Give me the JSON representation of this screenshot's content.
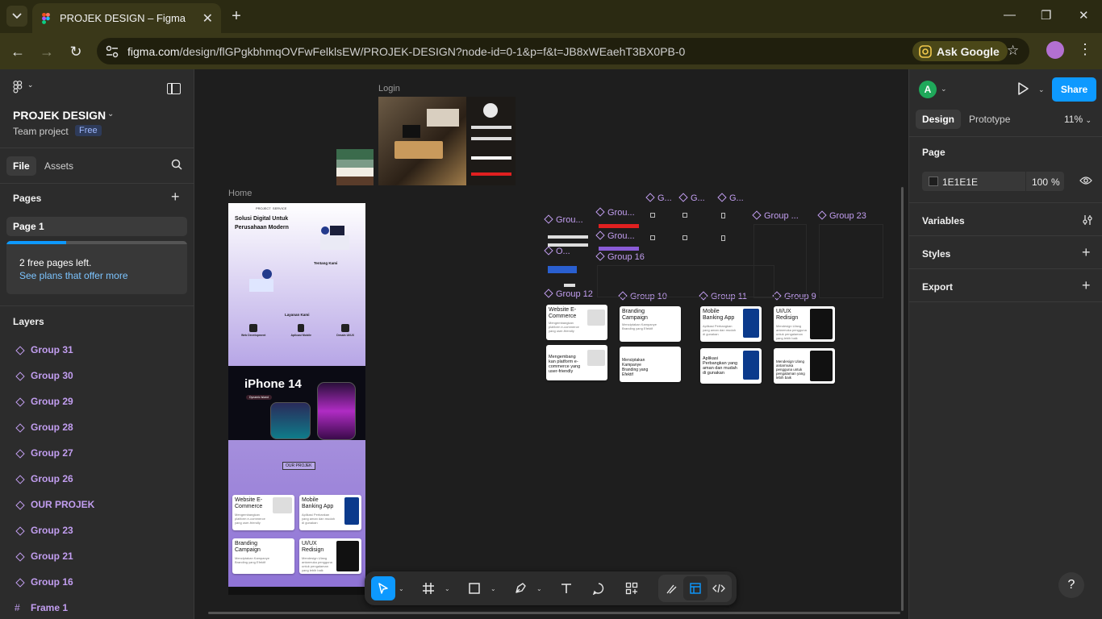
{
  "browser": {
    "tab_title": "PROJEK DESIGN – Figma",
    "url_main": "figma.com",
    "url_rest": "/design/flGPgkbhmqOVFwFelklsEW/PROJEK-DESIGN?node-id=0-1&p=f&t=JB8xWEaehT3BX0PB-0",
    "ask_google": "Ask Google",
    "colors": {
      "frame": "#2b2a12",
      "toolbar": "#3a3819"
    }
  },
  "left_panel": {
    "project_name": "PROJEK DESIGN",
    "team": "Team project",
    "plan_badge": "Free",
    "tabs": [
      "File",
      "Assets"
    ],
    "pages_title": "Pages",
    "pages": [
      "Page 1"
    ],
    "upsell": {
      "text": "2 free pages left.",
      "link": "See plans that offer more",
      "used_fraction": 0.33
    },
    "layers_title": "Layers",
    "layers": [
      {
        "label": "Group 31",
        "icon": "group-icon"
      },
      {
        "label": "Group 30",
        "icon": "group-icon"
      },
      {
        "label": "Group 29",
        "icon": "group-icon"
      },
      {
        "label": "Group 28",
        "icon": "group-icon"
      },
      {
        "label": "Group 27",
        "icon": "group-icon"
      },
      {
        "label": "Group 26",
        "icon": "group-icon"
      },
      {
        "label": "OUR PROJEK",
        "icon": "group-icon"
      },
      {
        "label": "Group 23",
        "icon": "group-icon"
      },
      {
        "label": "Group 21",
        "icon": "group-icon"
      },
      {
        "label": "Group 16",
        "icon": "group-icon"
      },
      {
        "label": "Frame 1",
        "icon": "frame-icon"
      }
    ]
  },
  "right_panel": {
    "avatar_initial": "A",
    "share": "Share",
    "tabs": [
      "Design",
      "Prototype"
    ],
    "zoom": "11%",
    "page_section": "Page",
    "bg_hex": "1E1E1E",
    "bg_opacity": "100",
    "opacity_unit": "%",
    "sections": [
      "Variables",
      "Styles",
      "Export"
    ],
    "help": "?"
  },
  "canvas": {
    "frame_labels": {
      "login": "Login",
      "home": "Home"
    },
    "group_labels": [
      "G...",
      "G...",
      "G...",
      "Grou...",
      "Grou...",
      "Grou...",
      "Group ...",
      "Group 23",
      "O...",
      "Group 16",
      "Group 12",
      "Group 10",
      "Group 11",
      "Group 9"
    ],
    "home": {
      "hero_title": "Solusi Digital Untuk Perusahaan Modern",
      "nav": [
        "PROJECT",
        "SERVICE"
      ],
      "about": "Tentang Kami",
      "services": "Layanan Kami",
      "service_items": [
        "Web Development",
        "Aplicasi Mobile",
        "Desain UI/UX"
      ],
      "iphone": "iPhone 14",
      "iphone_badge": "Dynamic Island",
      "our_projek": "OUR PROJEK",
      "cards": [
        {
          "title": "Website E-Commerce",
          "sub": "Mengembangkan platform e-commerce yang user-friendly"
        },
        {
          "title": "Mobile Banking App",
          "sub": "Aplikasi Perbankan yang aman dan mudah di gunakan"
        },
        {
          "title": "Branding Campaign",
          "sub": "Menciptakan Kampanye Branding yang Efektif"
        },
        {
          "title": "UI/UX Redisign",
          "sub": "Mendesign Ulang antarmuka pengguna untuk pengalaman yang lebih baik"
        }
      ]
    },
    "board_cards": [
      {
        "title": "Website E-Commerce",
        "sub": "Mengembangkan platform e-commerce yang user-friendly"
      },
      {
        "title": "Branding Campaign",
        "sub": "Menciptakan Kampanye Branding yang Efektif"
      },
      {
        "title": "Mobile Banking App",
        "sub": "Aplikasi Perbangkan yang aman dan mudah di gunakan"
      },
      {
        "title": "UI/UX Redisign",
        "sub": "Mendesign Ulang antarmuka pengguna untuk pengalaman yang lebih baik"
      },
      {
        "title": "Mengembang kan platform e-commerce yang user-friendly",
        "sub": ""
      },
      {
        "title": "Menciptakan Kampanye Branding yang Efektif",
        "sub": ""
      },
      {
        "title": "Aplikasi Perbangkan yang aman dan mudah di gunakan",
        "sub": ""
      },
      {
        "title": "Mendesign Ulang antarmuka pengguna untuk pengalaman yang lebih baik",
        "sub": ""
      }
    ]
  },
  "toolbar": {
    "tools": [
      "move-tool",
      "frame-tool",
      "shape-tool",
      "pen-tool",
      "text-tool",
      "comment-tool",
      "actions-tool"
    ],
    "modes": [
      "draw-mode",
      "design-mode",
      "dev-mode"
    ]
  },
  "accent": "#0d99ff",
  "group_color": "#c29ef0"
}
